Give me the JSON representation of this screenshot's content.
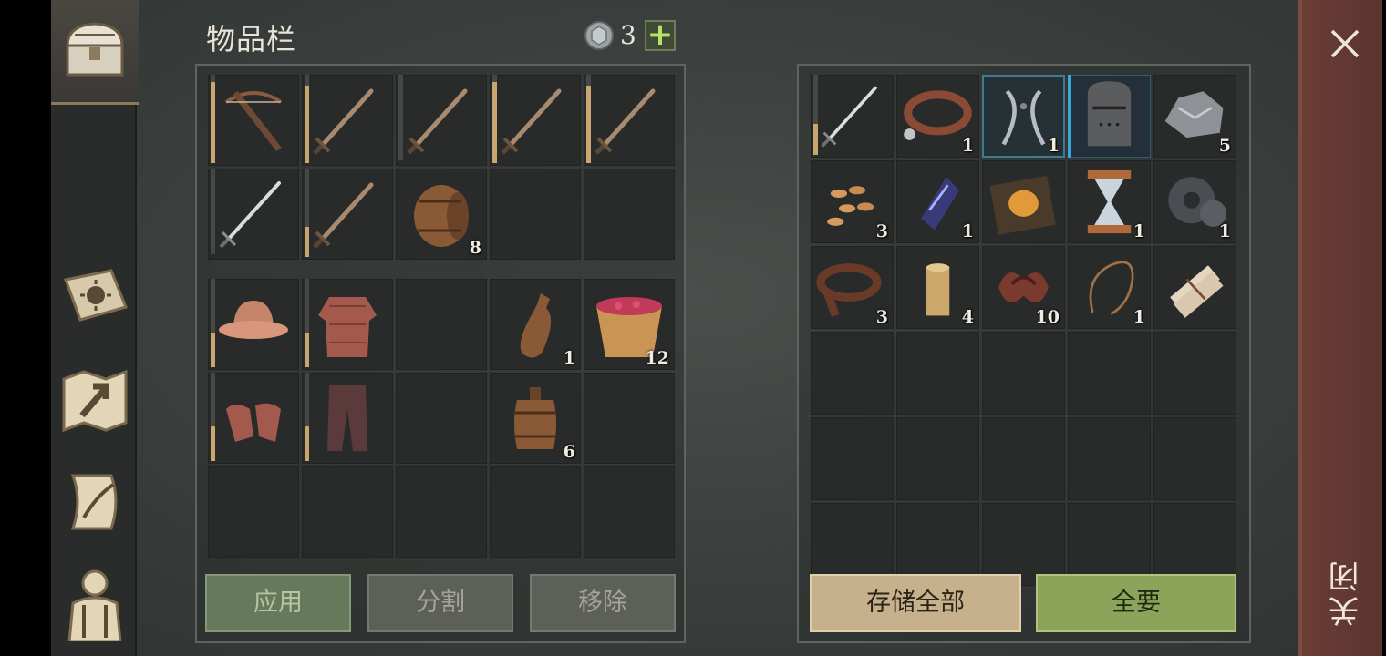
{
  "inventory": {
    "title": "物品栏",
    "currency_count": "3",
    "plus_label": "+",
    "weapons": [
      {
        "icon": "crossbow-icon",
        "qty": "",
        "durability": 0.95
      },
      {
        "icon": "sword-icon",
        "qty": "",
        "durability": 0.9
      },
      {
        "icon": "sword-icon",
        "qty": "",
        "durability": 0
      },
      {
        "icon": "sword-icon",
        "qty": "",
        "durability": 0.95
      },
      {
        "icon": "sword-icon",
        "qty": "",
        "durability": 0.9
      },
      {
        "icon": "steel-sword-icon",
        "qty": "",
        "durability": 0
      },
      {
        "icon": "sword-icon",
        "qty": "",
        "durability": 0.35
      },
      {
        "icon": "barrel-icon",
        "qty": "8"
      },
      {
        "icon": "",
        "qty": ""
      },
      {
        "icon": "",
        "qty": ""
      }
    ],
    "gear": [
      {
        "icon": "kettle-helmet-icon",
        "qty": "",
        "durability": 0.4
      },
      {
        "icon": "chainmail-icon",
        "qty": "",
        "durability": 0.4
      },
      {
        "icon": "",
        "qty": ""
      },
      {
        "icon": "bottle-icon",
        "qty": "1"
      },
      {
        "icon": "berry-bucket-icon",
        "qty": "12"
      },
      {
        "icon": "chain-gloves-icon",
        "qty": "",
        "durability": 0.4
      },
      {
        "icon": "chain-pants-icon",
        "qty": "",
        "durability": 0.4
      },
      {
        "icon": "",
        "qty": ""
      },
      {
        "icon": "small-barrel-icon",
        "qty": "6"
      },
      {
        "icon": "",
        "qty": ""
      }
    ],
    "buttons": {
      "apply": "应用",
      "split": "分割",
      "remove": "移除"
    }
  },
  "storage": {
    "items": [
      {
        "icon": "steel-sword-icon",
        "qty": "",
        "durability": 0.4
      },
      {
        "icon": "dog-collar-icon",
        "qty": "1"
      },
      {
        "icon": "pliers-icon",
        "qty": "1",
        "selected": true
      },
      {
        "icon": "great-helm-icon",
        "qty": "",
        "selected2": true
      },
      {
        "icon": "iron-ore-icon",
        "qty": "5"
      },
      {
        "icon": "seeds-icon",
        "qty": "3"
      },
      {
        "icon": "magic-crystal-icon",
        "qty": "1"
      },
      {
        "icon": "mask-book-icon",
        "qty": ""
      },
      {
        "icon": "hourglass-icon",
        "qty": "1"
      },
      {
        "icon": "gear-parts-icon",
        "qty": "1"
      },
      {
        "icon": "leather-strap-icon",
        "qty": "3"
      },
      {
        "icon": "candle-icon",
        "qty": "4"
      },
      {
        "icon": "guts-icon",
        "qty": "10"
      },
      {
        "icon": "rope-icon",
        "qty": "1"
      },
      {
        "icon": "scroll-bundle-icon",
        "qty": ""
      },
      {
        "icon": "",
        "qty": ""
      },
      {
        "icon": "",
        "qty": ""
      },
      {
        "icon": "",
        "qty": ""
      },
      {
        "icon": "",
        "qty": ""
      },
      {
        "icon": "",
        "qty": ""
      },
      {
        "icon": "",
        "qty": ""
      },
      {
        "icon": "",
        "qty": ""
      },
      {
        "icon": "",
        "qty": ""
      },
      {
        "icon": "",
        "qty": ""
      },
      {
        "icon": "",
        "qty": ""
      },
      {
        "icon": "",
        "qty": ""
      },
      {
        "icon": "",
        "qty": ""
      },
      {
        "icon": "",
        "qty": ""
      },
      {
        "icon": "",
        "qty": ""
      },
      {
        "icon": "",
        "qty": ""
      }
    ],
    "buttons": {
      "store_all": "存储全部",
      "take_all": "全要"
    }
  },
  "close": {
    "label": "关闭"
  },
  "colors": {
    "accent_tan": "#c9a56f",
    "button_green": "#8ca35a",
    "close_panel": "#6c3e36"
  }
}
